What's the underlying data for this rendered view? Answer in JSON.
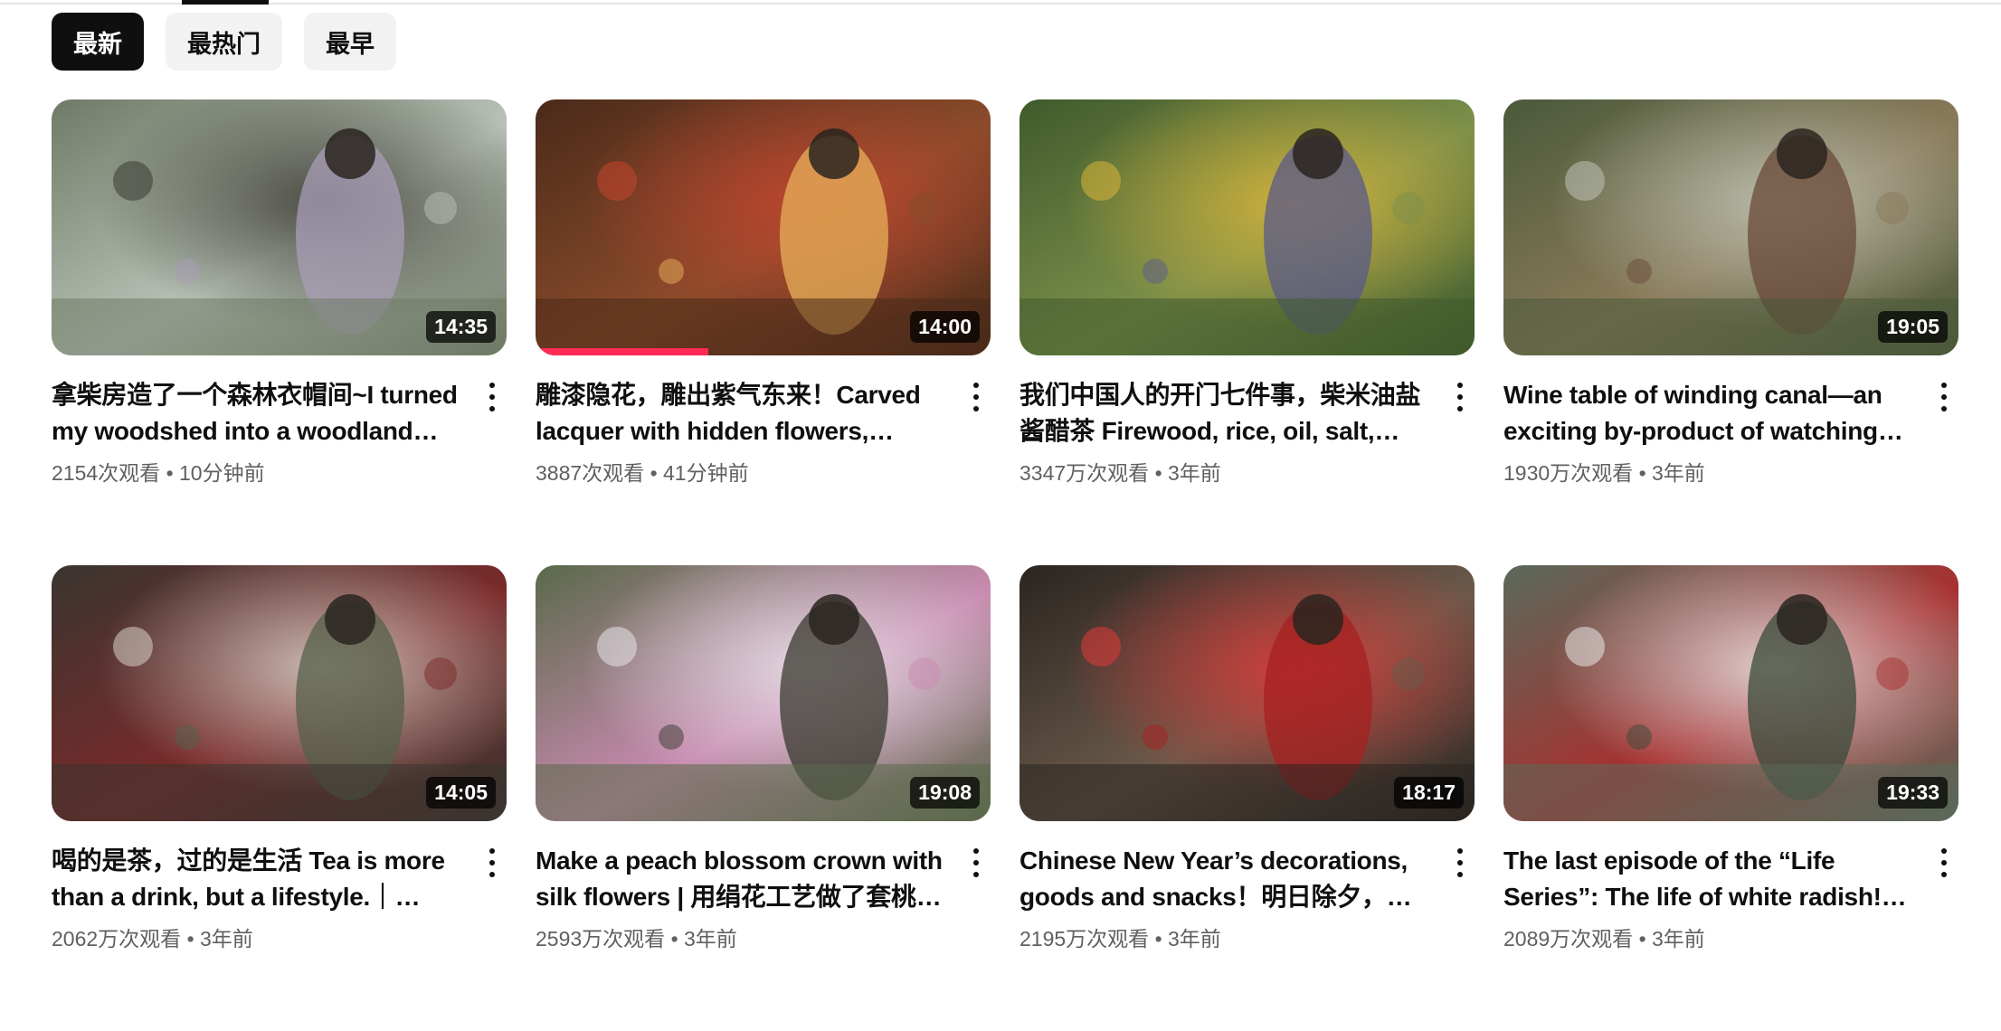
{
  "filters": [
    {
      "label": "最新",
      "active": true
    },
    {
      "label": "最热门",
      "active": false
    },
    {
      "label": "最早",
      "active": false
    }
  ],
  "videos": [
    {
      "title": "拿柴房造了一个森林衣帽间~I turned my woodshed into a woodland…",
      "views": "2154次观看",
      "age": "10分钟前",
      "duration": "14:35",
      "colors": [
        "#6f7a66",
        "#b9c2b7",
        "#3b3a33",
        "#a89db5"
      ]
    },
    {
      "title": "雕漆隐花，雕出紫气东来！Carved lacquer with hidden flowers,…",
      "views": "3887次观看",
      "age": "41分钟前",
      "duration": "14:00",
      "colors": [
        "#4a2a1a",
        "#8a4b2a",
        "#c4452f",
        "#e8b05a"
      ],
      "progress": 0.38
    },
    {
      "title": "我们中国人的开门七件事，柴米油盐酱醋茶 Firewood, rice, oil, salt, soy…",
      "views": "3347万次观看",
      "age": "3年前",
      "duration": "",
      "colors": [
        "#3f5a2c",
        "#7c8f4a",
        "#d9b53a",
        "#5a5a8a"
      ]
    },
    {
      "title": "Wine table of winding canal—an exciting by-product of watching T…",
      "views": "1930万次观看",
      "age": "3年前",
      "duration": "19:05",
      "colors": [
        "#4a5a3a",
        "#8a7a5a",
        "#bfc3b4",
        "#6a4a3a"
      ]
    },
    {
      "title": "喝的是茶，过的是生活 Tea is more than a drink, but a lifestyle.｜Liziqi…",
      "views": "2062万次观看",
      "age": "3年前",
      "duration": "14:05",
      "colors": [
        "#3a3530",
        "#7a2a2a",
        "#d8d2c8",
        "#55604a"
      ]
    },
    {
      "title": "Make a peach blossom crown with silk flowers | 用绢花工艺做了套桃…",
      "views": "2593万次观看",
      "age": "3年前",
      "duration": "19:08",
      "colors": [
        "#5a6a4a",
        "#c98ab0",
        "#e8e4ea",
        "#3a3a30"
      ]
    },
    {
      "title": "Chinese New Year’s decorations, goods and snacks！明日除夕，挂…",
      "views": "2195万次观看",
      "age": "3年前",
      "duration": "18:17",
      "colors": [
        "#2a2420",
        "#6a5a4a",
        "#e03a3a",
        "#a52020"
      ]
    },
    {
      "title": "The last episode of the “Life Series”: The life of white radish!一生系列产…",
      "views": "2089万次观看",
      "age": "3年前",
      "duration": "19:33",
      "colors": [
        "#5a6a5a",
        "#a83030",
        "#e8e8e8",
        "#3a4a3a"
      ]
    }
  ]
}
